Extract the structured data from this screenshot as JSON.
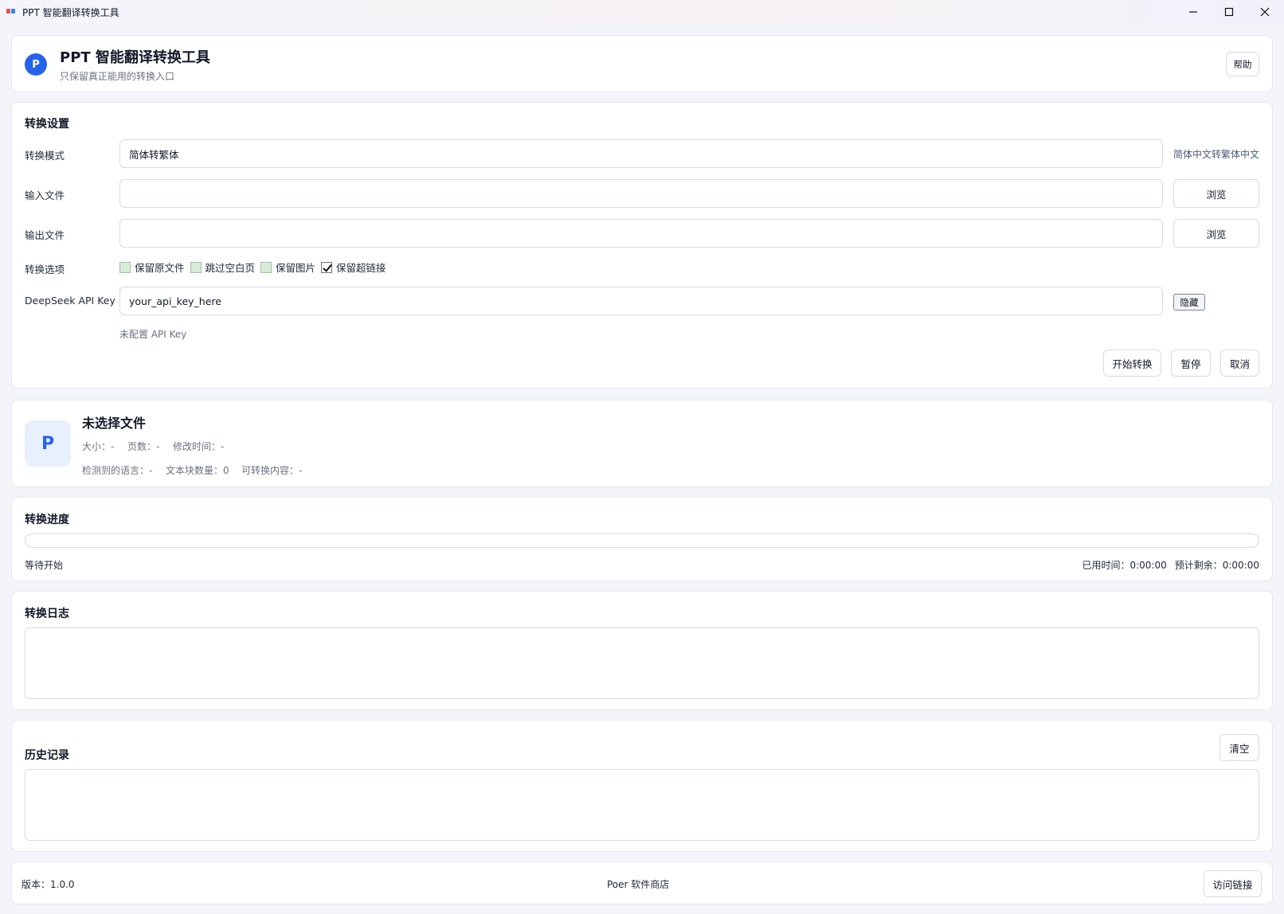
{
  "window": {
    "title": "PPT 智能翻译转换工具"
  },
  "header": {
    "avatar_letter": "P",
    "title": "PPT 智能翻译转换工具",
    "subtitle": "只保留真正能用的转换入口",
    "help_label": "帮助"
  },
  "settings": {
    "title": "转换设置",
    "mode": {
      "label": "转换模式",
      "value": "简体转繁体",
      "hint": "简体中文转繁体中文"
    },
    "input_file": {
      "label": "输入文件",
      "value": "",
      "browse_label": "浏览"
    },
    "output_file": {
      "label": "输出文件",
      "value": "",
      "browse_label": "浏览"
    },
    "options": {
      "label": "转换选项",
      "items": [
        {
          "label": "保留原文件",
          "checked": false
        },
        {
          "label": "跳过空白页",
          "checked": false
        },
        {
          "label": "保留图片",
          "checked": false
        },
        {
          "label": "保留超链接",
          "checked": true
        }
      ]
    },
    "api_key": {
      "label": "DeepSeek API Key",
      "value": "your_api_key_here",
      "toggle_label": "隐藏",
      "status": "未配置 API Key"
    },
    "actions": {
      "start_label": "开始转换",
      "pause_label": "暂停",
      "cancel_label": "取消"
    }
  },
  "file_info": {
    "icon_letter": "P",
    "name": "未选择文件",
    "size": "大小：-",
    "pages": "页数：-",
    "modified": "修改时间：-",
    "language": "检测到的语言：-",
    "blocks": "文本块数量：0",
    "convertible": "可转换内容：-"
  },
  "progress": {
    "title": "转换进度",
    "value": 0,
    "status": "等待开始",
    "elapsed": "已用时间：0:00:00",
    "remaining": "预计剩余：0:00:00"
  },
  "log": {
    "title": "转换日志",
    "content": ""
  },
  "history": {
    "title": "历史记录",
    "clear_label": "清空",
    "content": ""
  },
  "footer": {
    "version": "版本：1.0.0",
    "store": "Poer 软件商店",
    "visit_label": "访问链接"
  },
  "colors": {
    "accent": "#2563eb",
    "card_bg": "#ffffff",
    "page_bg": "#f3f5fa",
    "border": "#e3e7ef"
  }
}
